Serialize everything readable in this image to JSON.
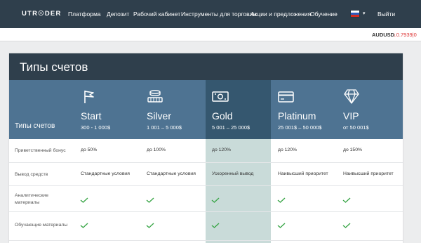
{
  "header": {
    "logo": "UTR☉DER",
    "nav": [
      "Платформа",
      "Депозит",
      "Рабочий кабинет",
      "Инструменты для торговли",
      "Акции и предложения",
      "Обучение"
    ],
    "language_flag": "flag-ru-icon",
    "logout": "Выйти"
  },
  "ticker": {
    "symbol": "AUDUSD",
    "value": "↓0.7939|0"
  },
  "card": {
    "title": "Типы счетов",
    "plans_label": "Типы счетов",
    "plans": [
      {
        "name": "Start",
        "range": "300 - 1 000$",
        "icon": "flag-icon"
      },
      {
        "name": "Silver",
        "range": "1 001 – 5 000$",
        "icon": "coins-icon"
      },
      {
        "name": "Gold",
        "range": "5 001 – 25 000$",
        "icon": "banknote-icon",
        "highlight": true
      },
      {
        "name": "Platinum",
        "range": "25 001$ – 50 000$",
        "icon": "credit-card-icon"
      },
      {
        "name": "VIP",
        "range": "от 50 001$",
        "icon": "diamond-icon"
      }
    ],
    "rows": [
      {
        "label": "Приветственный бонус",
        "values": [
          "до 50%",
          "до 100%",
          "до 120%",
          "до 120%",
          "до 150%"
        ]
      },
      {
        "label": "Вывод средств",
        "values": [
          "Стандартные условия",
          "Стандартные условия",
          "Ускоренный вывод",
          "Наивысший приоритет",
          "Наивысший приоритет"
        ]
      },
      {
        "label": "Аналитические материалы",
        "values": [
          "check",
          "check",
          "check",
          "check",
          "check"
        ]
      },
      {
        "label": "Обучающие материалы",
        "values": [
          "check",
          "check",
          "check",
          "check",
          "check"
        ]
      }
    ]
  },
  "colors": {
    "header_bg": "#2f3f4c",
    "plans_bg": "#4e7392",
    "gold_bg": "#35576f",
    "highlight_col": "#c9dbd9",
    "check": "#3aa648"
  }
}
